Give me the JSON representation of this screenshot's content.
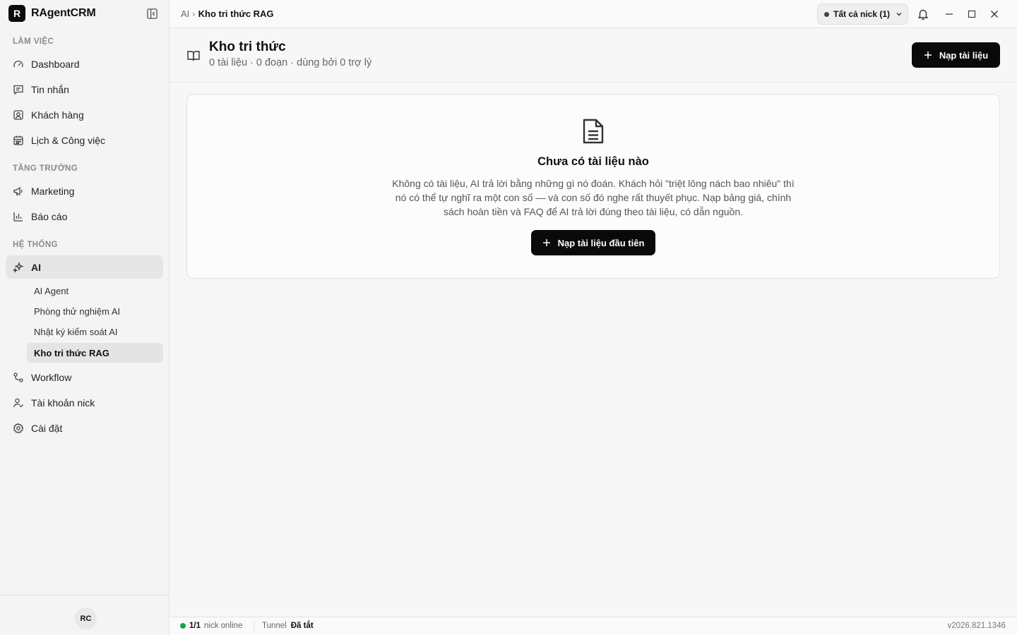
{
  "brand": {
    "logo_letter": "R",
    "name": "RAgentCRM"
  },
  "sidebar": {
    "sections": [
      {
        "label": "LÀM VIỆC"
      },
      {
        "label": "TĂNG TRƯỞNG"
      },
      {
        "label": "HỆ THỐNG"
      }
    ],
    "items": [
      {
        "label": "Dashboard",
        "icon": "gauge-icon"
      },
      {
        "label": "Tin nhắn",
        "icon": "message-icon"
      },
      {
        "label": "Khách hàng",
        "icon": "contact-icon"
      },
      {
        "label": "Lịch & Công việc",
        "icon": "calendar-icon"
      },
      {
        "label": "Marketing",
        "icon": "megaphone-icon"
      },
      {
        "label": "Báo cáo",
        "icon": "bar-chart-icon"
      },
      {
        "label": "AI",
        "icon": "sparkles-icon",
        "active": true
      },
      {
        "label": "Workflow",
        "icon": "workflow-icon"
      },
      {
        "label": "Tài khoản nick",
        "icon": "user-check-icon"
      },
      {
        "label": "Cài đặt",
        "icon": "gear-icon"
      }
    ],
    "ai_subitems": [
      {
        "label": "AI Agent"
      },
      {
        "label": "Phòng thử nghiệm AI"
      },
      {
        "label": "Nhật ký kiểm soát AI"
      },
      {
        "label": "Kho tri thức RAG",
        "active": true
      }
    ],
    "avatar_initials": "RC"
  },
  "topbar": {
    "breadcrumb": {
      "parent": "AI",
      "separator": "›",
      "current": "Kho tri thức RAG"
    },
    "nick_select": "Tất cả nick (1)"
  },
  "page": {
    "title": "Kho tri thức",
    "subtitle": "0 tài liệu · 0 đoạn · dùng bởi 0 trợ lý",
    "primary_button": "Nạp tài liệu"
  },
  "empty_state": {
    "title": "Chưa có tài liệu nào",
    "description": "Không có tài liệu, AI trả lời bằng những gì nó đoán. Khách hỏi \"triệt lông nách bao nhiêu\" thì nó có thể tự nghĩ ra một con số — và con số đó nghe rất thuyết phục. Nạp bảng giá, chính sách hoàn tiền và FAQ để AI trả lời đúng theo tài liệu, có dẫn nguồn.",
    "button": "Nạp tài liệu đầu tiên"
  },
  "statusbar": {
    "online_count": "1/1",
    "online_label": "nick online",
    "tunnel_label": "Tunnel",
    "tunnel_status": "Đã tắt",
    "version": "v2026.821.1346"
  },
  "colors": {
    "primary": "#0a0a0a",
    "online": "#17a34a",
    "sidebar_bg": "#f4f4f4"
  }
}
